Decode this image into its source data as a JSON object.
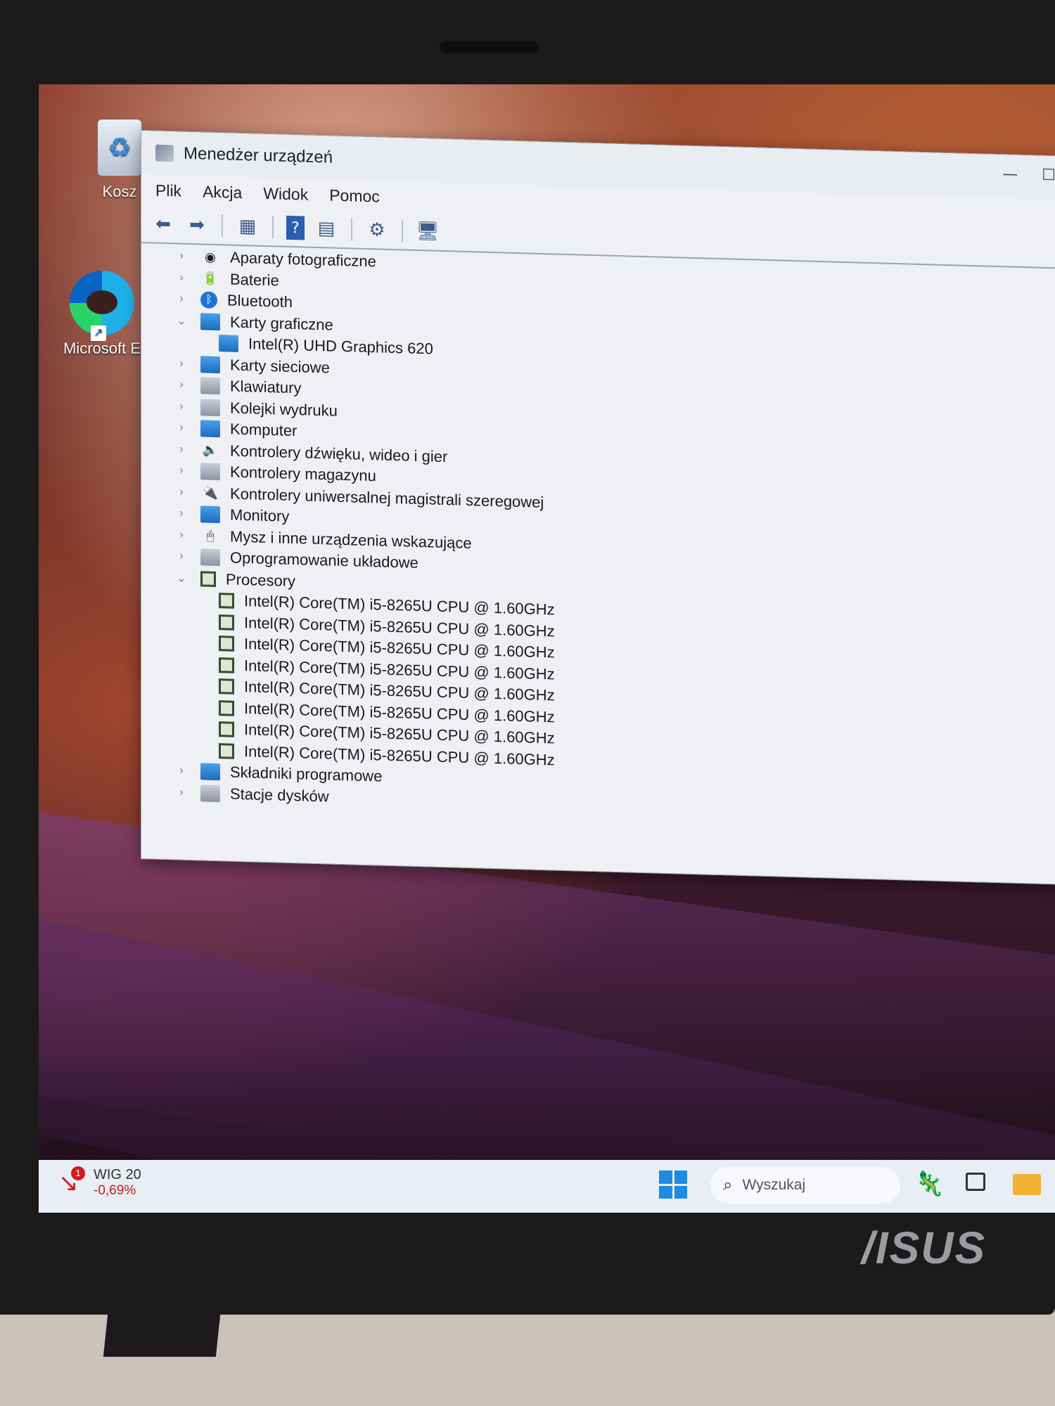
{
  "desktop": {
    "recycle_bin_label": "Kosz",
    "edge_label": "Microsoft E"
  },
  "window": {
    "title": "Menedżer urządzeń",
    "minimize": "—",
    "maximize": "☐",
    "menu": [
      "Plik",
      "Akcja",
      "Widok",
      "Pomoc"
    ]
  },
  "tree": [
    {
      "type": "cat",
      "expanded": false,
      "label": "Aparaty fotograficzne",
      "icon": "camera-icon"
    },
    {
      "type": "cat",
      "expanded": false,
      "label": "Baterie",
      "icon": "battery-icon"
    },
    {
      "type": "cat",
      "expanded": false,
      "label": "Bluetooth",
      "icon": "bluetooth-icon"
    },
    {
      "type": "cat",
      "expanded": true,
      "label": "Karty graficzne",
      "icon": "display-adapter-icon"
    },
    {
      "type": "child",
      "label": "Intel(R) UHD Graphics 620",
      "icon": "display-adapter-icon"
    },
    {
      "type": "cat",
      "expanded": false,
      "label": "Karty sieciowe",
      "icon": "network-adapter-icon"
    },
    {
      "type": "cat",
      "expanded": false,
      "label": "Klawiatury",
      "icon": "keyboard-icon"
    },
    {
      "type": "cat",
      "expanded": false,
      "label": "Kolejki wydruku",
      "icon": "printer-icon"
    },
    {
      "type": "cat",
      "expanded": false,
      "label": "Komputer",
      "icon": "computer-icon"
    },
    {
      "type": "cat",
      "expanded": false,
      "label": "Kontrolery dźwięku, wideo i gier",
      "icon": "speaker-icon"
    },
    {
      "type": "cat",
      "expanded": false,
      "label": "Kontrolery magazynu",
      "icon": "storage-controller-icon"
    },
    {
      "type": "cat",
      "expanded": false,
      "label": "Kontrolery uniwersalnej magistrali szeregowej",
      "icon": "usb-icon"
    },
    {
      "type": "cat",
      "expanded": false,
      "label": "Monitory",
      "icon": "monitor-icon"
    },
    {
      "type": "cat",
      "expanded": false,
      "label": "Mysz i inne urządzenia wskazujące",
      "icon": "mouse-icon"
    },
    {
      "type": "cat",
      "expanded": false,
      "label": "Oprogramowanie układowe",
      "icon": "firmware-icon"
    },
    {
      "type": "cat",
      "expanded": true,
      "label": "Procesory",
      "icon": "cpu-icon"
    },
    {
      "type": "child",
      "label": "Intel(R) Core(TM) i5-8265U CPU @ 1.60GHz",
      "icon": "cpu-icon"
    },
    {
      "type": "child",
      "label": "Intel(R) Core(TM) i5-8265U CPU @ 1.60GHz",
      "icon": "cpu-icon"
    },
    {
      "type": "child",
      "label": "Intel(R) Core(TM) i5-8265U CPU @ 1.60GHz",
      "icon": "cpu-icon"
    },
    {
      "type": "child",
      "label": "Intel(R) Core(TM) i5-8265U CPU @ 1.60GHz",
      "icon": "cpu-icon"
    },
    {
      "type": "child",
      "label": "Intel(R) Core(TM) i5-8265U CPU @ 1.60GHz",
      "icon": "cpu-icon"
    },
    {
      "type": "child",
      "label": "Intel(R) Core(TM) i5-8265U CPU @ 1.60GHz",
      "icon": "cpu-icon"
    },
    {
      "type": "child",
      "label": "Intel(R) Core(TM) i5-8265U CPU @ 1.60GHz",
      "icon": "cpu-icon"
    },
    {
      "type": "child",
      "label": "Intel(R) Core(TM) i5-8265U CPU @ 1.60GHz",
      "icon": "cpu-icon"
    },
    {
      "type": "cat",
      "expanded": false,
      "label": "Składniki programowe",
      "icon": "software-component-icon"
    },
    {
      "type": "cat",
      "expanded": false,
      "label": "Stacje dysków",
      "icon": "disk-drive-icon"
    }
  ],
  "taskbar": {
    "widget_title": "WIG 20",
    "widget_value": "-0,69%",
    "widget_badge": "1",
    "search_placeholder": "Wyszukaj"
  },
  "laptop_brand": "/ISUS"
}
